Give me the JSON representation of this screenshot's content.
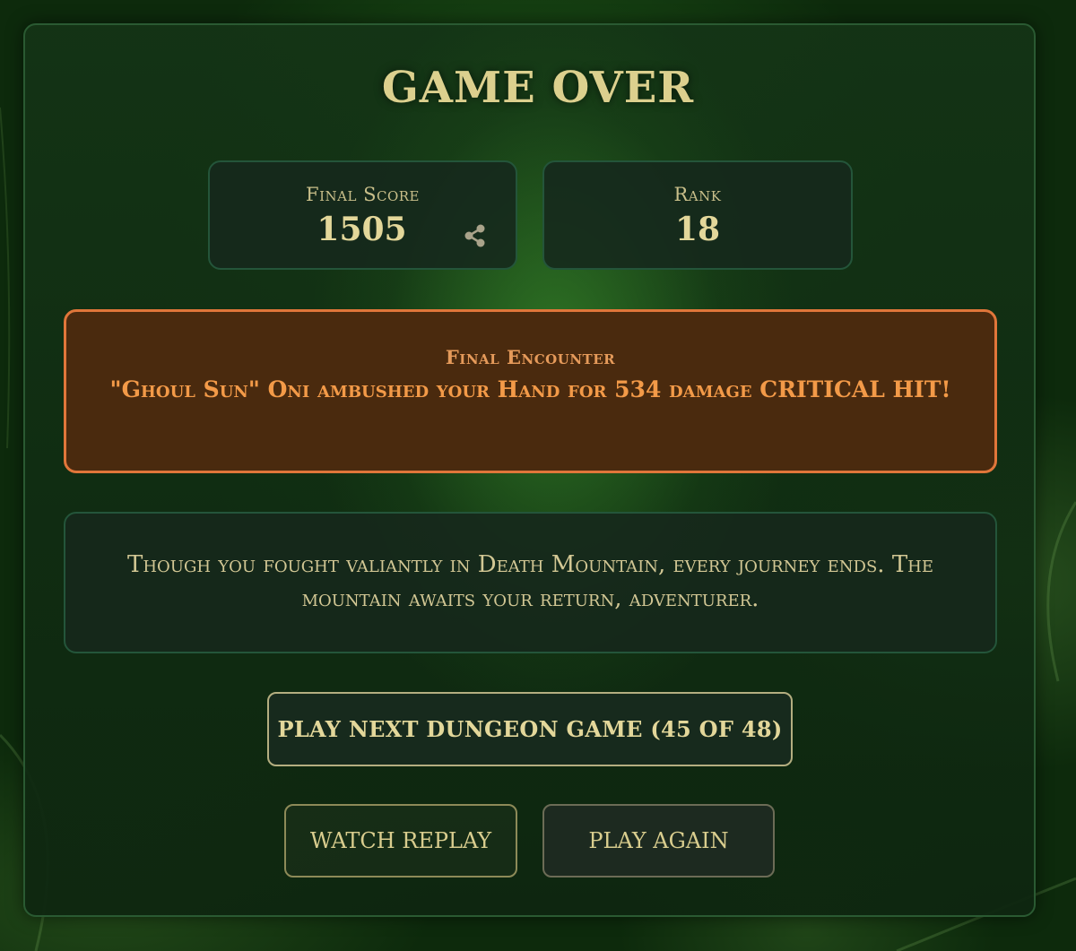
{
  "title": "GAME OVER",
  "stats": {
    "score_label": "Final Score",
    "score_value": "1505",
    "rank_label": "Rank",
    "rank_value": "18",
    "share_icon": "share-icon"
  },
  "encounter": {
    "label": "Final Encounter",
    "text": "\"Ghoul Sun\" Oni ambushed your Hand for 534 damage CRITICAL HIT!"
  },
  "message": {
    "text": "Though you fought valiantly in Death Mountain, every journey ends. The mountain awaits your return, adventurer."
  },
  "buttons": {
    "next_game": "PLAY NEXT DUNGEON GAME (45 OF 48)",
    "watch_replay": "WATCH REPLAY",
    "play_again": "PLAY AGAIN"
  },
  "colors": {
    "gold": "#dcd08e",
    "encounter_border": "#e0763a",
    "encounter_text": "#f39a48",
    "panel_border": "#2a5a32"
  }
}
